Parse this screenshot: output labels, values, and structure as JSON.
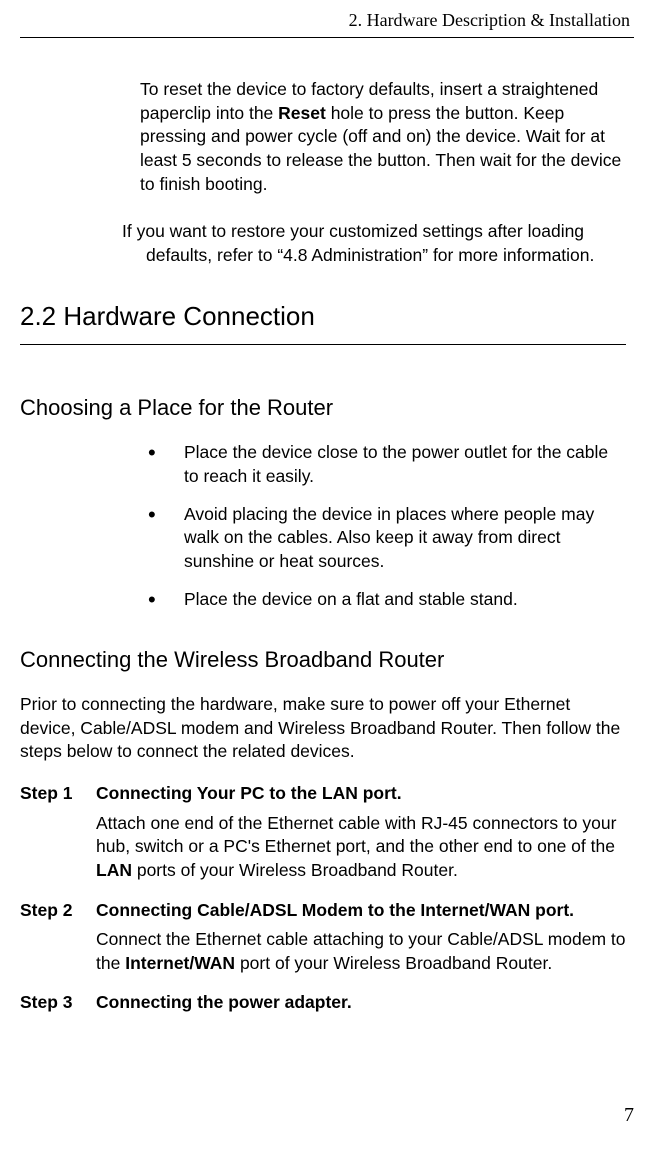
{
  "header": {
    "chapter": "2. Hardware Description & Installation"
  },
  "reset": {
    "p1a": "To reset the device to factory defaults, insert a straightened paperclip into the ",
    "p1b": "Reset",
    "p1c": " hole to press the button. Keep pressing and power cycle (off and on) the device. Wait for at least 5 seconds to release the button. Then wait for the device to finish booting."
  },
  "restore": {
    "l1": "If you want to restore your customized settings after loading",
    "l2": "defaults, refer to “4.8 Administration” for more information."
  },
  "section": {
    "title": "2.2 Hardware Connection"
  },
  "choosing": {
    "heading": "Choosing a Place for the Router",
    "items": [
      "Place the device close to the power outlet for the cable to reach it easily.",
      "Avoid placing the device in places where people may walk on the cables. Also keep it away from direct sunshine or heat sources.",
      "Place the device on a flat and stable stand."
    ]
  },
  "connecting": {
    "heading": "Connecting the Wireless Broadband Router",
    "intro": "Prior to connecting the hardware, make sure to power off your Ethernet device, Cable/ADSL modem and Wireless Broadband Router. Then follow the steps below to connect the related devices.",
    "steps": [
      {
        "label": "Step 1",
        "title": "Connecting Your PC to the LAN port.",
        "text_a": "Attach one end of the Ethernet cable with RJ-45 connectors to your hub, switch or a PC's Ethernet port, and the other end to one of the ",
        "text_b": "LAN",
        "text_c": " ports of your Wireless Broadband Router."
      },
      {
        "label": "Step 2",
        "title": "Connecting Cable/ADSL Modem to the Internet/WAN port.",
        "text_a": "Connect the Ethernet cable attaching to your Cable/ADSL modem to the ",
        "text_b": "Internet/WAN",
        "text_c": " port of your Wireless Broadband Router."
      },
      {
        "label": "Step 3",
        "title": "Connecting the power adapter.",
        "text_a": "",
        "text_b": "",
        "text_c": ""
      }
    ]
  },
  "page_number": "7"
}
